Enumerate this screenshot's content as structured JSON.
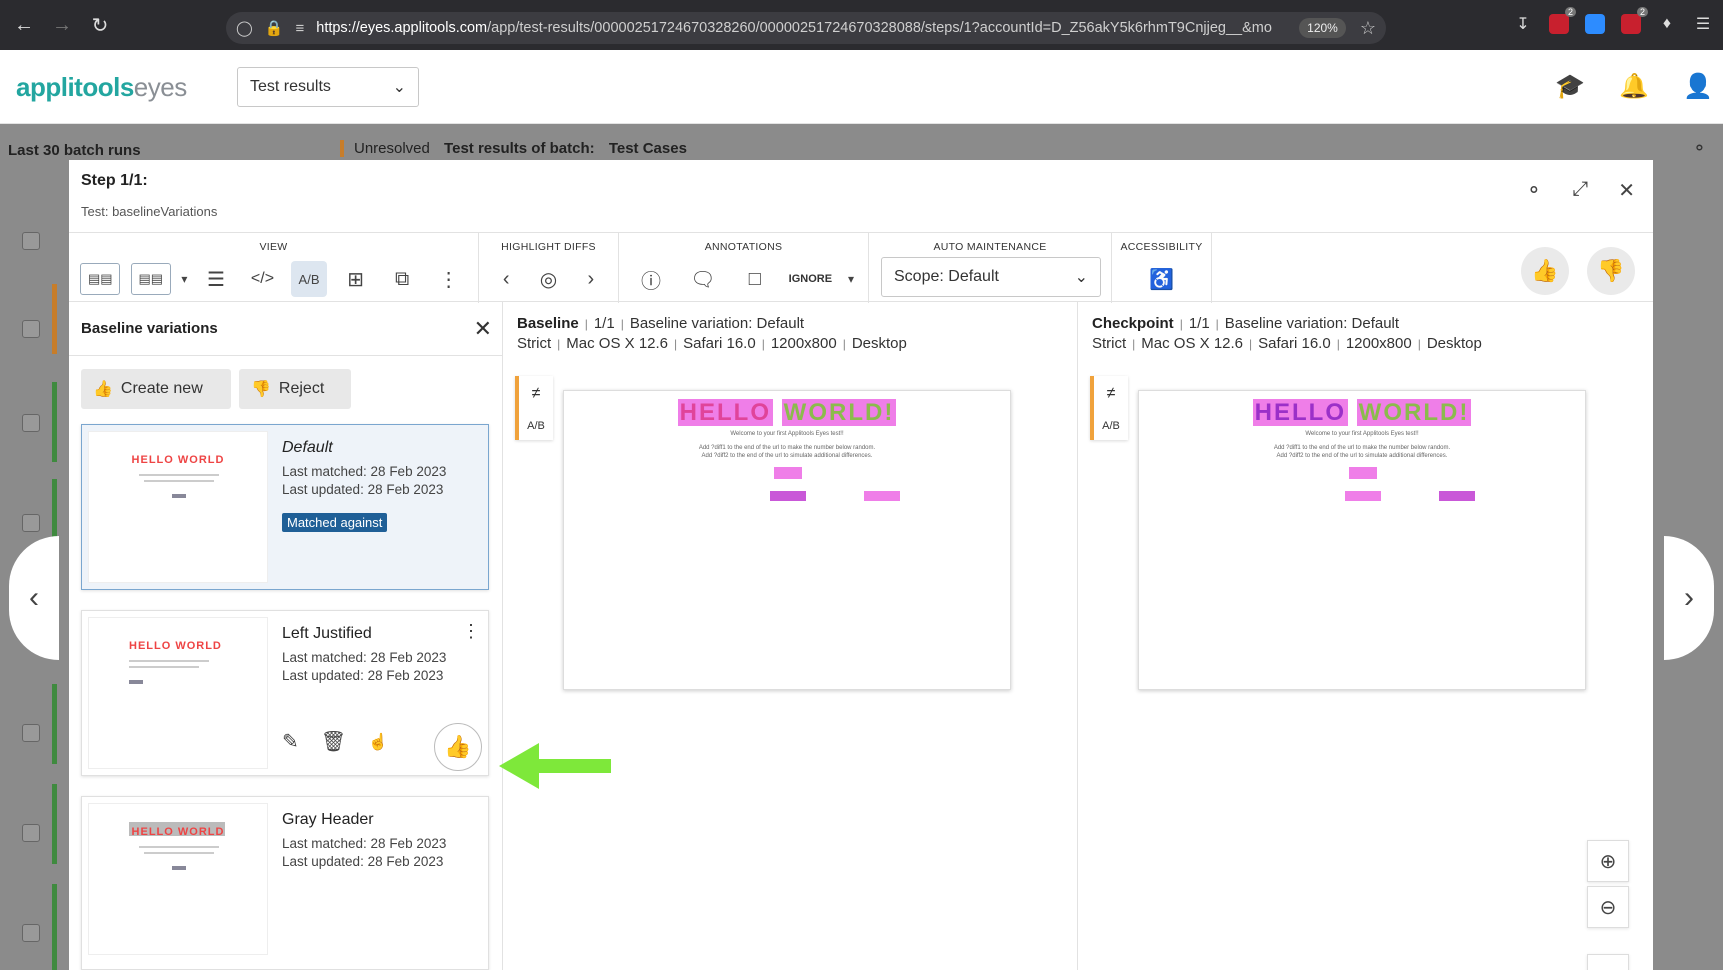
{
  "browser": {
    "url_domain": "https://eyes.applitools.com",
    "url_path": "/app/test-results/00000251724670328260/00000251724670328088/steps/1?accountId=D_Z56akY5k6rhmT9Cnjjeg__&mo",
    "zoom": "120%",
    "ext_badge_1": "2",
    "ext_badge_2": "2"
  },
  "header": {
    "logo_brand": "applitools",
    "logo_product": "eyes",
    "section_select": "Test results"
  },
  "background": {
    "left_title": "Last 30 batch runs",
    "status": "Unresolved",
    "batch_label": "Test results of batch:",
    "batch_name": "Test Cases"
  },
  "modal": {
    "step_title": "Step 1/1:",
    "test_name": "Test: baselineVariations"
  },
  "toolbar": {
    "view_label": "VIEW",
    "highlight_label": "HIGHLIGHT DIFFS",
    "annotations_label": "ANNOTATIONS",
    "ignore_label": "IGNORE",
    "auto_maint_label": "AUTO MAINTENANCE",
    "scope_value": "Scope: Default",
    "accessibility_label": "ACCESSIBILITY"
  },
  "sidebar": {
    "title": "Baseline variations",
    "create_label": "Create new",
    "reject_label": "Reject",
    "variations": [
      {
        "name": "Default",
        "last_matched": "Last matched: 28 Feb 2023",
        "last_updated": "Last updated: 28 Feb 2023",
        "badge": "Matched against"
      },
      {
        "name": "Left Justified",
        "last_matched": "Last matched: 28 Feb 2023",
        "last_updated": "Last updated: 28 Feb 2023"
      },
      {
        "name": "Gray Header",
        "last_matched": "Last matched: 28 Feb 2023",
        "last_updated": "Last updated: 28 Feb 2023"
      }
    ]
  },
  "baseline": {
    "title": "Baseline",
    "count": "1/1",
    "variation": "Baseline variation: Default",
    "match": "Strict",
    "os": "Mac OS X 12.6",
    "browser": "Safari 16.0",
    "size": "1200x800",
    "device": "Desktop"
  },
  "checkpoint": {
    "title": "Checkpoint",
    "count": "1/1",
    "variation": "Baseline variation: Default",
    "match": "Strict",
    "os": "Mac OS X 12.6",
    "browser": "Safari 16.0",
    "size": "1200x800",
    "device": "Desktop"
  },
  "shot": {
    "hello": "HELLO",
    "world": "WORLD!",
    "welcome": "Welcome to your first Applitools Eyes test!!",
    "line1": "Add ?diff1 to the end of the url to make the number below random.",
    "line2": "Add ?diff2 to the end of the url to simulate additional differences."
  },
  "colors": {
    "brand_teal": "#23a6a0",
    "highlight_pink": "#ef7ee8",
    "matched_badge": "#1f5f97",
    "arrow_green": "#7ee83a",
    "baseline_marker": "#f0a23c"
  }
}
